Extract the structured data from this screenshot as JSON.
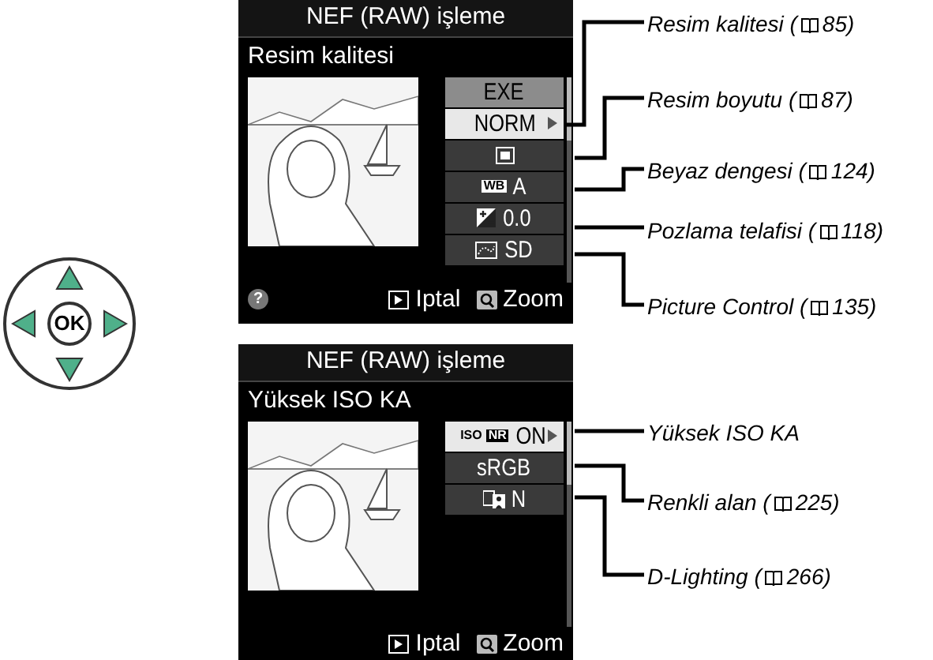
{
  "selector": {
    "center_label": "OK"
  },
  "screens": [
    {
      "title": "NEF (RAW) işleme",
      "subtitle": "Resim kalitesi",
      "help": "?",
      "cancel": "Iptal",
      "zoom": "Zoom",
      "options": [
        {
          "kind": "execute",
          "value": "EXE",
          "selected": false
        },
        {
          "kind": "text",
          "value": "NORM",
          "selected": true
        },
        {
          "kind": "image_size",
          "selected": false
        },
        {
          "kind": "badge",
          "badge": "WB",
          "value": "A",
          "selected": false
        },
        {
          "kind": "exposure",
          "value": "0.0",
          "selected": false
        },
        {
          "kind": "picture_control",
          "value": "SD",
          "selected": false
        }
      ],
      "callouts": [
        {
          "text": "Resim kalitesi (",
          "page": "85)"
        },
        {
          "text": "Resim boyutu (",
          "page": "87)"
        },
        {
          "text": "Beyaz dengesi (",
          "page": "124)"
        },
        {
          "text": "Pozlama telafisi (",
          "page": "118)"
        },
        {
          "text": "Picture Control (",
          "page": "135)"
        }
      ]
    },
    {
      "title": "NEF (RAW) işleme",
      "subtitle": "Yüksek ISO KA",
      "cancel": "Iptal",
      "zoom": "Zoom",
      "options": [
        {
          "kind": "badge",
          "prefix": "ISO",
          "badge": "NR",
          "value": "ON",
          "selected": true
        },
        {
          "kind": "text",
          "value": "sRGB",
          "selected": false
        },
        {
          "kind": "d_lighting",
          "value": "N",
          "selected": false
        }
      ],
      "callouts": [
        {
          "text": "Yüksek ISO KA"
        },
        {
          "text": "Renkli alan (",
          "page": "225)"
        },
        {
          "text": "D-Lighting (",
          "page": "266)"
        }
      ]
    }
  ]
}
